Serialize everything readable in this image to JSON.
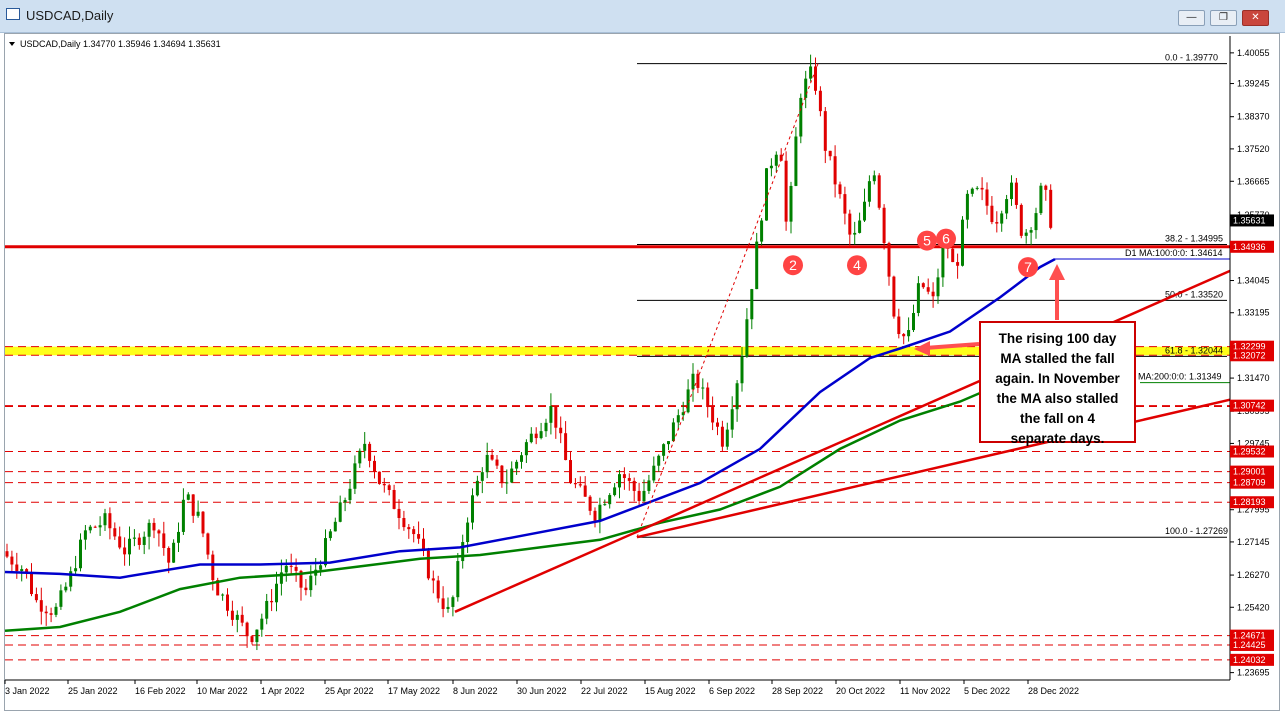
{
  "window": {
    "title": "USDCAD,Daily",
    "buttons": [
      {
        "label": "—",
        "name": "minimize-button"
      },
      {
        "label": "❐",
        "name": "restore-button"
      },
      {
        "label": "✕",
        "name": "close-button"
      }
    ]
  },
  "chart_data": {
    "type": "candlestick",
    "symbol_header": "USDCAD,Daily  1.34770 1.35946 1.34694 1.35631",
    "ylim": [
      1.235,
      1.405
    ],
    "y_ticks": [
      "1.40055",
      "1.39245",
      "1.38370",
      "1.37520",
      "1.36665",
      "1.35770",
      "1.34945",
      "1.34045",
      "1.33195",
      "1.32345",
      "1.31470",
      "1.30595",
      "1.29745",
      "1.28870",
      "1.27995",
      "1.27145",
      "1.26270",
      "1.25420",
      "1.24545",
      "1.23695"
    ],
    "x_ticks": [
      "3 Jan 2022",
      "25 Jan 2022",
      "16 Feb 2022",
      "10 Mar 2022",
      "1 Apr 2022",
      "25 Apr 2022",
      "17 May 2022",
      "8 Jun 2022",
      "30 Jun 2022",
      "22 Jul 2022",
      "15 Aug 2022",
      "6 Sep 2022",
      "28 Sep 2022",
      "20 Oct 2022",
      "11 Nov 2022",
      "5 Dec 2022",
      "28 Dec 2022"
    ],
    "current_price": "1.35631",
    "price_tags": [
      {
        "value": 1.35631,
        "text": "1.35631",
        "color": "#000000"
      },
      {
        "value": 1.34936,
        "text": "1.34936",
        "color": "#e00000"
      },
      {
        "value": 1.32299,
        "text": "1.32299",
        "color": "#e00000"
      },
      {
        "value": 1.32072,
        "text": "1.32072",
        "color": "#e00000"
      },
      {
        "value": 1.30742,
        "text": "1.30742",
        "color": "#e00000"
      },
      {
        "value": 1.29532,
        "text": "1.29532",
        "color": "#e00000"
      },
      {
        "value": 1.29001,
        "text": "1.29001",
        "color": "#e00000"
      },
      {
        "value": 1.28709,
        "text": "1.28709",
        "color": "#e00000"
      },
      {
        "value": 1.28193,
        "text": "1.28193",
        "color": "#e00000"
      },
      {
        "value": 1.24671,
        "text": "1.24671",
        "color": "#e00000"
      },
      {
        "value": 1.24425,
        "text": "1.24425",
        "color": "#e00000"
      },
      {
        "value": 1.24032,
        "text": "1.24032",
        "color": "#e00000"
      }
    ],
    "fib_levels": [
      {
        "text": "0.0 - 1.39770",
        "value": 1.3977
      },
      {
        "text": "38.2 - 1.34995",
        "value": 1.34995
      },
      {
        "text": "50.0 - 1.33520",
        "value": 1.3352
      },
      {
        "text": "61.8 - 1.32044",
        "value": 1.32044
      },
      {
        "text": "100.0 - 1.27269",
        "value": 1.27269
      }
    ],
    "ma_labels": [
      {
        "text": "D1 MA:100:0:0: 1.34614",
        "value": 1.34614,
        "color": "#0000cc"
      },
      {
        "text": "MA:200:0:0: 1.31349",
        "value": 1.31349,
        "color": "#006400"
      }
    ],
    "dashed_levels": [
      1.30742,
      1.3072,
      1.29532,
      1.29001,
      1.28709,
      1.28193,
      1.24671,
      1.24425,
      1.24032
    ],
    "solid_level": 1.34936,
    "yellow_band": [
      1.32072,
      1.32299
    ],
    "markers": [
      "2",
      "4",
      "5",
      "6",
      "7"
    ],
    "annotation": {
      "lines": [
        "The rising 100 day",
        "MA stalled the fall",
        "again. In November",
        "the MA also stalled",
        "the fall on 4",
        "separate days."
      ]
    },
    "colors": {
      "bull": "#008000",
      "bear": "#e00000",
      "ma100": "#0000cc",
      "ma200": "#008000",
      "trend": "#e00000",
      "marker": "#ff4444"
    }
  }
}
